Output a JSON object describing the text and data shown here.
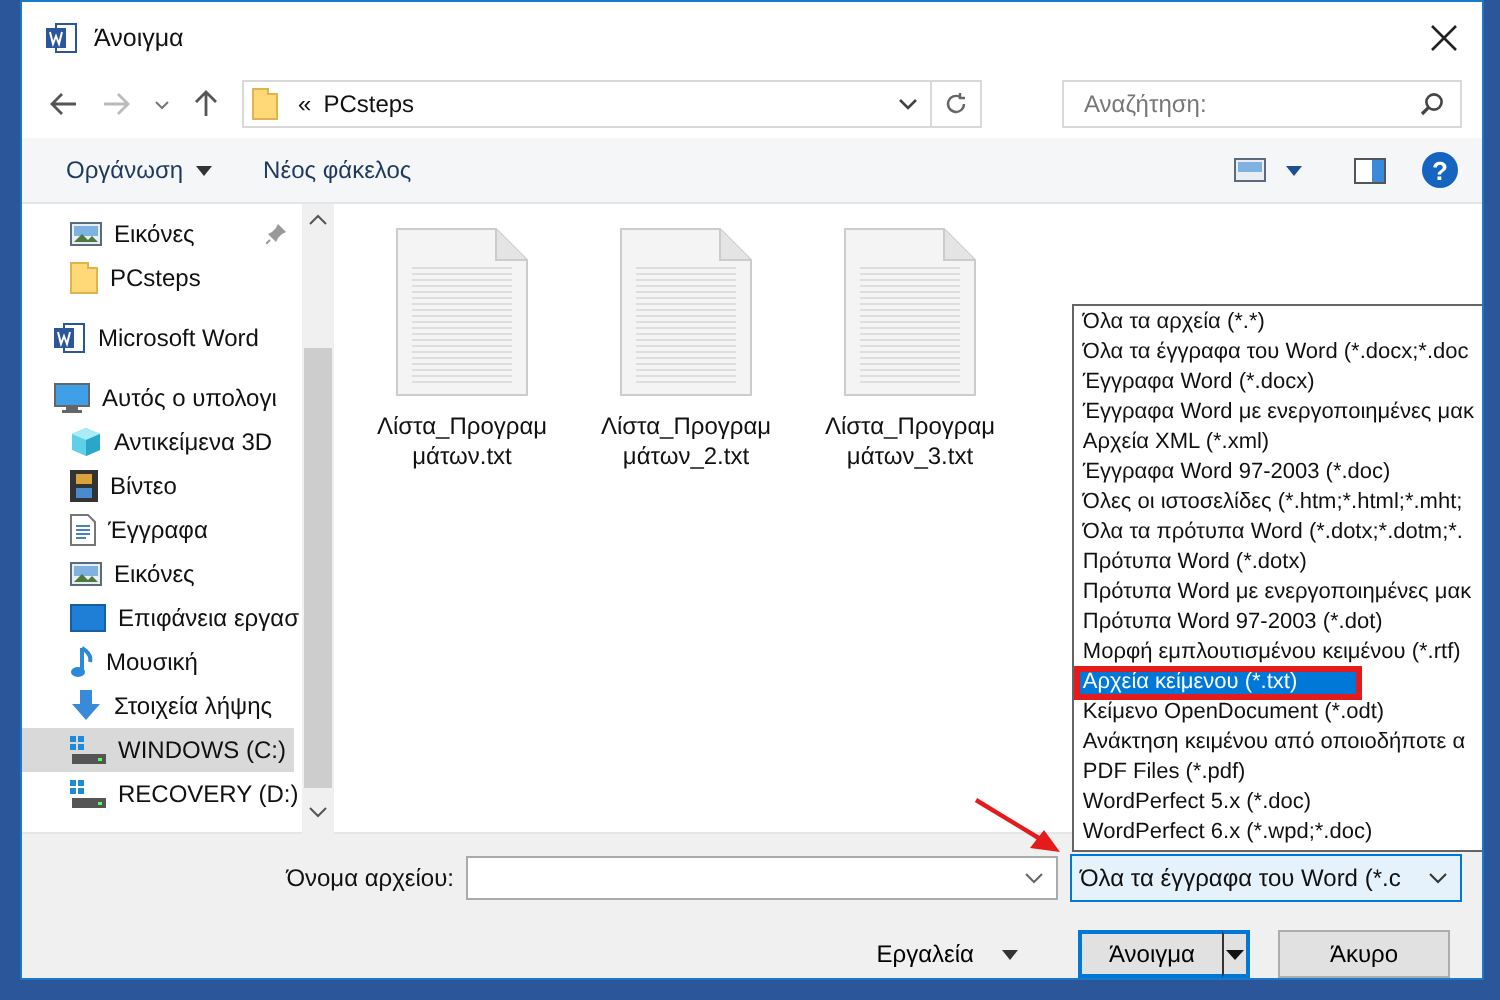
{
  "window": {
    "title": "Άνοιγμα"
  },
  "address_bar": {
    "overflow": "«",
    "path": "PCsteps"
  },
  "search": {
    "placeholder": "Αναζήτηση:"
  },
  "toolbar": {
    "organize": "Οργάνωση",
    "new_folder": "Νέος φάκελος",
    "help": "?"
  },
  "sidebar": {
    "quick_access": [
      {
        "label": "Εικόνες",
        "kind": "pictures",
        "pinned": true,
        "selected": false
      },
      {
        "label": "PCsteps",
        "kind": "folder",
        "pinned": false,
        "selected": false
      }
    ],
    "items": [
      {
        "label": "Microsoft Word",
        "kind": "word",
        "selected": false
      },
      {
        "label": "Αυτός ο υπολογι",
        "kind": "pc",
        "selected": false,
        "children": [
          {
            "label": "Αντικείμενα 3D",
            "kind": "objects3d",
            "selected": false
          },
          {
            "label": "Βίντεο",
            "kind": "video",
            "selected": false
          },
          {
            "label": "Έγγραφα",
            "kind": "documents",
            "selected": false
          },
          {
            "label": "Εικόνες",
            "kind": "pictures",
            "selected": false
          },
          {
            "label": "Επιφάνεια εργασ",
            "kind": "desktop",
            "selected": false
          },
          {
            "label": "Μουσική",
            "kind": "music",
            "selected": false
          },
          {
            "label": "Στοιχεία λήψης",
            "kind": "downloads",
            "selected": false
          },
          {
            "label": "WINDOWS (C:)",
            "kind": "drive",
            "selected": true
          },
          {
            "label": "RECOVERY (D:)",
            "kind": "drive",
            "selected": false
          }
        ]
      }
    ]
  },
  "files": [
    {
      "lines": [
        "Λίστα_Προγραμ",
        "μάτων.txt"
      ]
    },
    {
      "lines": [
        "Λίστα_Προγραμ",
        "μάτων_2.txt"
      ]
    },
    {
      "lines": [
        "Λίστα_Προγραμ",
        "μάτων_3.txt"
      ]
    }
  ],
  "filename": {
    "label": "Όνομα αρχείου:"
  },
  "filetype": {
    "value": "Όλα τα έγγραφα του Word (*.c",
    "expanded": true,
    "options": [
      {
        "label": "Όλα τα αρχεία (*.*)",
        "selected": false,
        "outlined": false
      },
      {
        "label": "Όλα τα έγγραφα του Word (*.docx;*.doc",
        "selected": false,
        "outlined": false
      },
      {
        "label": "Έγγραφα Word (*.docx)",
        "selected": false,
        "outlined": false
      },
      {
        "label": "Έγγραφα Word με ενεργοποιημένες μακ",
        "selected": false,
        "outlined": false
      },
      {
        "label": "Αρχεία XML (*.xml)",
        "selected": false,
        "outlined": false
      },
      {
        "label": "Έγγραφα Word 97-2003 (*.doc)",
        "selected": false,
        "outlined": false
      },
      {
        "label": "Όλες οι ιστοσελίδες (*.htm;*.html;*.mht;",
        "selected": false,
        "outlined": false
      },
      {
        "label": "Όλα τα πρότυπα Word (*.dotx;*.dotm;*.",
        "selected": false,
        "outlined": false
      },
      {
        "label": "Πρότυπα Word (*.dotx)",
        "selected": false,
        "outlined": false
      },
      {
        "label": "Πρότυπα Word με ενεργοποιημένες μακ",
        "selected": false,
        "outlined": false
      },
      {
        "label": "Πρότυπα Word 97-2003 (*.dot)",
        "selected": false,
        "outlined": false
      },
      {
        "label": "Μορφή εμπλουτισμένου κειμένου (*.rtf)",
        "selected": false,
        "outlined": false
      },
      {
        "label": "Αρχεία κείμενου (*.txt)",
        "selected": true,
        "outlined": true
      },
      {
        "label": "Κείμενο OpenDocument (*.odt)",
        "selected": false,
        "outlined": false
      },
      {
        "label": "Ανάκτηση κειμένου από οποιοδήποτε α",
        "selected": false,
        "outlined": false
      },
      {
        "label": "PDF Files (*.pdf)",
        "selected": false,
        "outlined": false
      },
      {
        "label": "WordPerfect 5.x (*.doc)",
        "selected": false,
        "outlined": false
      },
      {
        "label": "WordPerfect 6.x (*.wpd;*.doc)",
        "selected": false,
        "outlined": false
      }
    ]
  },
  "buttons": {
    "tools": "Εργαλεία",
    "open": "Άνοιγμα",
    "cancel": "Άκυρο"
  }
}
